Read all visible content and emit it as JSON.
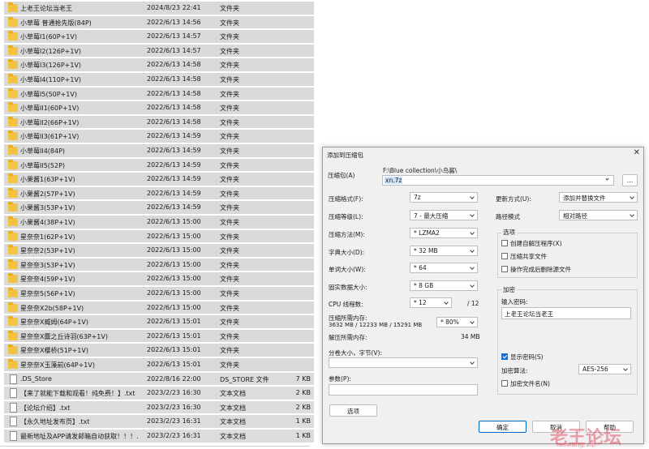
{
  "files": [
    {
      "name": "上老王论坛当老王",
      "date": "2024/8/23 22:41",
      "type": "文件夹",
      "size": "",
      "kind": "folder"
    },
    {
      "name": "小草莓 普通抢先版(84P)",
      "date": "2022/6/13 14:56",
      "type": "文件夹",
      "size": "",
      "kind": "folder"
    },
    {
      "name": "小草莓I1(60P+1V)",
      "date": "2022/6/13 14:57",
      "type": "文件夹",
      "size": "",
      "kind": "folder"
    },
    {
      "name": "小草莓I2(126P+1V)",
      "date": "2022/6/13 14:57",
      "type": "文件夹",
      "size": "",
      "kind": "folder"
    },
    {
      "name": "小草莓I3(126P+1V)",
      "date": "2022/6/13 14:58",
      "type": "文件夹",
      "size": "",
      "kind": "folder"
    },
    {
      "name": "小草莓I4(110P+1V)",
      "date": "2022/6/13 14:58",
      "type": "文件夹",
      "size": "",
      "kind": "folder"
    },
    {
      "name": "小草莓I5(50P+1V)",
      "date": "2022/6/13 14:58",
      "type": "文件夹",
      "size": "",
      "kind": "folder"
    },
    {
      "name": "小草莓II1(60P+1V)",
      "date": "2022/6/13 14:58",
      "type": "文件夹",
      "size": "",
      "kind": "folder"
    },
    {
      "name": "小草莓II2(66P+1V)",
      "date": "2022/6/13 14:58",
      "type": "文件夹",
      "size": "",
      "kind": "folder"
    },
    {
      "name": "小草莓II3(61P+1V)",
      "date": "2022/6/13 14:59",
      "type": "文件夹",
      "size": "",
      "kind": "folder"
    },
    {
      "name": "小草莓II4(84P)",
      "date": "2022/6/13 14:59",
      "type": "文件夹",
      "size": "",
      "kind": "folder"
    },
    {
      "name": "小草莓II5(52P)",
      "date": "2022/6/13 14:59",
      "type": "文件夹",
      "size": "",
      "kind": "folder"
    },
    {
      "name": "小果酱1(63P+1V)",
      "date": "2022/6/13 14:59",
      "type": "文件夹",
      "size": "",
      "kind": "folder"
    },
    {
      "name": "小果酱2(57P+1V)",
      "date": "2022/6/13 14:59",
      "type": "文件夹",
      "size": "",
      "kind": "folder"
    },
    {
      "name": "小果酱3(53P+1V)",
      "date": "2022/6/13 14:59",
      "type": "文件夹",
      "size": "",
      "kind": "folder"
    },
    {
      "name": "小果酱4(38P+1V)",
      "date": "2022/6/13 15:00",
      "type": "文件夹",
      "size": "",
      "kind": "folder"
    },
    {
      "name": "星奈奈1(62P+1V)",
      "date": "2022/6/13 15:00",
      "type": "文件夹",
      "size": "",
      "kind": "folder"
    },
    {
      "name": "星奈奈2(53P+1V)",
      "date": "2022/6/13 15:00",
      "type": "文件夹",
      "size": "",
      "kind": "folder"
    },
    {
      "name": "星奈奈3(53P+1V)",
      "date": "2022/6/13 15:00",
      "type": "文件夹",
      "size": "",
      "kind": "folder"
    },
    {
      "name": "星奈奈4(59P+1V)",
      "date": "2022/6/13 15:00",
      "type": "文件夹",
      "size": "",
      "kind": "folder"
    },
    {
      "name": "星奈奈5(56P+1V)",
      "date": "2022/6/13 15:00",
      "type": "文件夹",
      "size": "",
      "kind": "folder"
    },
    {
      "name": "星奈奈X2b(58P+1V)",
      "date": "2022/6/13 15:00",
      "type": "文件夹",
      "size": "",
      "kind": "folder"
    },
    {
      "name": "星奈奈X臧姆(64P+1V)",
      "date": "2022/6/13 15:01",
      "type": "文件夹",
      "size": "",
      "kind": "folder"
    },
    {
      "name": "星奈奈X麋之丘诗羽(63P+1V)",
      "date": "2022/6/13 15:01",
      "type": "文件夹",
      "size": "",
      "kind": "folder"
    },
    {
      "name": "星奈奈X樱桥(51P+1V)",
      "date": "2022/6/13 15:01",
      "type": "文件夹",
      "size": "",
      "kind": "folder"
    },
    {
      "name": "星奈奈X玉藻前(64P+1V)",
      "date": "2022/6/13 15:01",
      "type": "文件夹",
      "size": "",
      "kind": "folder"
    },
    {
      "name": ".DS_Store",
      "date": "2022/8/16 22:00",
      "type": "DS_STORE 文件",
      "size": "7 KB",
      "kind": "file"
    },
    {
      "name": "【来了就能下载和观看！纯免费！】.txt",
      "date": "2023/2/23 16:30",
      "type": "文本文档",
      "size": "2 KB",
      "kind": "file"
    },
    {
      "name": "【论坛介绍】.txt",
      "date": "2023/2/23 16:30",
      "type": "文本文档",
      "size": "2 KB",
      "kind": "file"
    },
    {
      "name": "【永久地址发布页】.txt",
      "date": "2023/2/23 16:31",
      "type": "文本文档",
      "size": "1 KB",
      "kind": "file"
    },
    {
      "name": "最新地址及APP请发邮箱自动获取！！！....",
      "date": "2023/2/23 16:31",
      "type": "文本文档",
      "size": "1 KB",
      "kind": "file"
    }
  ],
  "dialog": {
    "title": "添加到压缩包",
    "close_glyph": "✕",
    "archive_label": "压缩包(A)",
    "archive_path": "F:\\Blue collection\\小鸟酱\\",
    "archive_name": "xn.7z",
    "browse_label": "...",
    "format_label": "压缩格式(F):",
    "format_value": "7z",
    "level_label": "压缩等级(L):",
    "level_value": "7 - 最大压缩",
    "method_label": "压缩方法(M):",
    "method_value": "* LZMA2",
    "dict_label": "字典大小(D):",
    "dict_value": "* 32 MB",
    "word_label": "单词大小(W):",
    "word_value": "* 64",
    "solid_label": "固实数据大小:",
    "solid_value": "* 8 GB",
    "threads_label": "CPU 线程数:",
    "threads_value": "* 12",
    "threads_total": "/ 12",
    "mem_label": "压缩所需内存:",
    "mem_detail": "3632 MB / 12233 MB / 15291 MB",
    "mem_pct": "* 80%",
    "decomp_label": "解压所需内存:",
    "decomp_value": "34 MB",
    "split_label": "分卷大小，字节(V):",
    "params_label": "参数(P):",
    "options_button": "选项",
    "update_label": "更新方式(U):",
    "update_value": "添加并替换文件",
    "path_label": "路径模式",
    "path_value": "相对路径",
    "opts_group": "选项",
    "opt_sfx": "创建自解压程序(X)",
    "opt_shared": "压缩共享文件",
    "opt_delete": "操作完成后删除源文件",
    "enc_group": "加密",
    "pwd_label": "输入密码:",
    "pwd_value": "上老王论坛当老王",
    "show_pwd": "显示密码(S)",
    "enc_method_label": "加密算法:",
    "enc_method_value": "AES-256",
    "enc_names": "加密文件名(N)",
    "ok": "确定",
    "cancel": "取消",
    "help": "帮助"
  },
  "watermark": {
    "text": "老王论坛",
    "url": "laowang.vip"
  }
}
